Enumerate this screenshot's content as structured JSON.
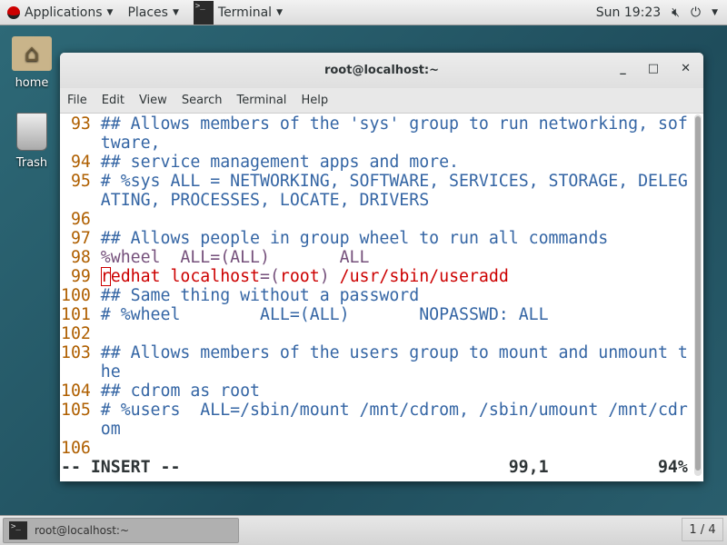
{
  "topbar": {
    "applications": "Applications",
    "places": "Places",
    "terminal": "Terminal",
    "clock": "Sun 19:23"
  },
  "desktop": {
    "home": "home",
    "trash": "Trash"
  },
  "window": {
    "title": "root@localhost:~",
    "menu": [
      "File",
      "Edit",
      "View",
      "Search",
      "Terminal",
      "Help"
    ]
  },
  "editor": {
    "lines": [
      {
        "n": "93",
        "segs": [
          {
            "t": "## Allows members of the 'sys' group to run networking, software,",
            "c": "c"
          }
        ]
      },
      {
        "n": "94",
        "segs": [
          {
            "t": "## service management apps and more.",
            "c": "c"
          }
        ]
      },
      {
        "n": "95",
        "segs": [
          {
            "t": "# %sys ALL = NETWORKING, SOFTWARE, SERVICES, STORAGE, DELEGATING, PROCESSES, LOCATE, DRIVERS",
            "c": "c"
          }
        ]
      },
      {
        "n": "96",
        "segs": [
          {
            "t": "",
            "c": "c"
          }
        ]
      },
      {
        "n": "97",
        "segs": [
          {
            "t": "## Allows people in group wheel to run all commands",
            "c": "c"
          }
        ]
      },
      {
        "n": "98",
        "segs": [
          {
            "t": "%wheel  ALL=(ALL)       ALL",
            "c": "p"
          }
        ]
      },
      {
        "n": "99",
        "segs": [
          {
            "t": "r",
            "c": "r cursor"
          },
          {
            "t": "edhat localhost",
            "c": "r"
          },
          {
            "t": "=(",
            "c": "p"
          },
          {
            "t": "root",
            "c": "r"
          },
          {
            "t": ")",
            "c": "p"
          },
          {
            "t": " /usr/sbin/useradd",
            "c": "r"
          }
        ]
      },
      {
        "n": "100",
        "segs": [
          {
            "t": "## Same thing without a password",
            "c": "c"
          }
        ]
      },
      {
        "n": "101",
        "segs": [
          {
            "t": "# %wheel        ALL=(ALL)       NOPASSWD: ALL",
            "c": "c"
          }
        ]
      },
      {
        "n": "102",
        "segs": [
          {
            "t": "",
            "c": "c"
          }
        ]
      },
      {
        "n": "103",
        "segs": [
          {
            "t": "## Allows members of the users group to mount and unmount the",
            "c": "c"
          }
        ]
      },
      {
        "n": "104",
        "segs": [
          {
            "t": "## cdrom as root",
            "c": "c"
          }
        ]
      },
      {
        "n": "105",
        "segs": [
          {
            "t": "# %users  ALL=/sbin/mount /mnt/cdrom, /sbin/umount /mnt/cdrom",
            "c": "c"
          }
        ]
      },
      {
        "n": "106",
        "segs": [
          {
            "t": "",
            "c": "c"
          }
        ]
      }
    ],
    "mode": "-- INSERT --",
    "position": "99,1",
    "percent": "94%"
  },
  "colors": {
    "line_number": "#af5f00",
    "comment": "#3465a4",
    "keyword": "#75507b",
    "user_rule": "#cc0000"
  },
  "taskbar": {
    "task": "root@localhost:~",
    "workspace": "1 / 4"
  }
}
